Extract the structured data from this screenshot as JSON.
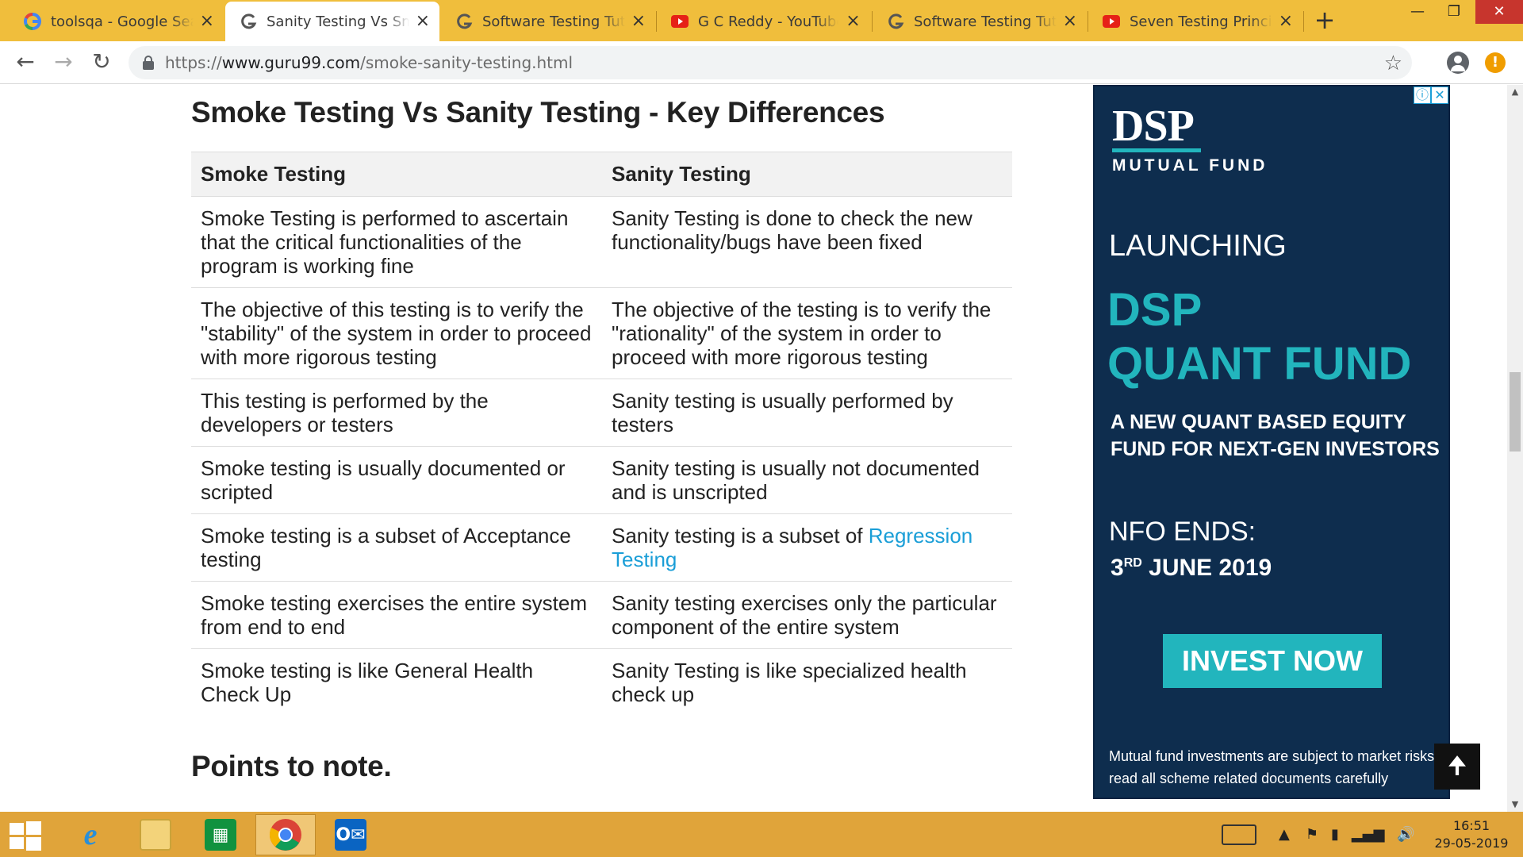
{
  "browser": {
    "tabs": [
      {
        "title": "toolsqa - Google Search",
        "favicon": "google-icon",
        "active": false
      },
      {
        "title": "Sanity Testing Vs Smoke Testing",
        "favicon": "guru99-icon",
        "active": true
      },
      {
        "title": "Software Testing Tutorial",
        "favicon": "guru99-icon",
        "active": false
      },
      {
        "title": "G C Reddy - YouTube",
        "favicon": "youtube-icon",
        "active": false
      },
      {
        "title": "Software Testing Tutorial",
        "favicon": "guru99-icon",
        "active": false
      },
      {
        "title": "Seven Testing Principles",
        "favicon": "youtube-icon",
        "active": false
      }
    ],
    "new_tab": "+",
    "close_glyph": "×",
    "url_scheme": "https://",
    "url_host": "www.guru99.com",
    "url_path": "/smoke-sanity-testing.html"
  },
  "page": {
    "heading": "Smoke Testing Vs Sanity Testing - Key Differences",
    "table": {
      "headers": [
        "Smoke Testing",
        "Sanity Testing"
      ],
      "rows": [
        [
          "Smoke Testing is performed to ascertain that the critical functionalities of the program is working fine",
          "Sanity Testing is done to check the new functionality/bugs have been fixed"
        ],
        [
          "The objective of this testing is to verify the \"stability\" of the system in order to proceed with more rigorous testing",
          "The objective of the testing is to verify the \"rationality\" of the system in order to proceed with more rigorous testing"
        ],
        [
          "This testing is performed by the developers or testers",
          "Sanity testing is usually performed by testers"
        ],
        [
          "Smoke testing is usually documented or scripted",
          "Sanity testing is usually not documented and is unscripted"
        ],
        [
          "Smoke testing is a subset of Acceptance testing",
          "Sanity testing is a subset of "
        ],
        [
          "Smoke testing exercises the entire system from end to end",
          "Sanity testing exercises only the particular component of the entire system"
        ],
        [
          "Smoke testing is like General Health Check Up",
          "Sanity Testing is like specialized health check up"
        ]
      ],
      "link_text": "Regression Testing",
      "link_color": "#1a9ed7"
    },
    "subheading": "Points to note."
  },
  "ad": {
    "logo": "DSP",
    "logo_sub": "MUTUAL FUND",
    "launching": "LAUNCHING",
    "line1": "DSP",
    "line2": "QUANT FUND",
    "description": "A NEW QUANT BASED EQUITY FUND FOR NEXT-GEN INVESTORS",
    "nfo": "NFO ENDS:",
    "date_day": "3",
    "date_suffix": "RD",
    "date_rest": " JUNE 2019",
    "cta": "INVEST NOW",
    "disclaimer": "Mutual fund investments are subject to market risks, read all scheme related documents carefully",
    "bg_color": "#0e2d4e",
    "accent_color": "#22b5bd"
  },
  "taskbar": {
    "time": "16:51",
    "date": "29-05-2019",
    "apps": [
      "internet-explorer-icon",
      "file-explorer-icon",
      "store-icon",
      "chrome-icon",
      "outlook-icon"
    ]
  }
}
